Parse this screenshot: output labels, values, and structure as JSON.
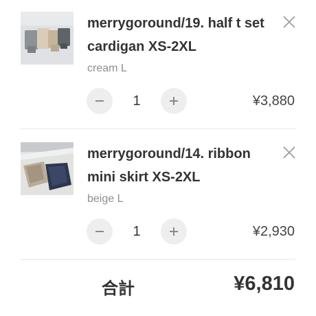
{
  "cart": {
    "items": [
      {
        "title_line1": "merrygoround/19. half t set",
        "title_line2": "cardigan XS-2XL",
        "variant": "cream L",
        "quantity": "1",
        "price": "¥3,880",
        "thumbnail_icon": "product-photo-cardigan-set"
      },
      {
        "title_line1": "merrygoround/14. ribbon",
        "title_line2": "mini skirt XS-2XL",
        "variant": "beige L",
        "quantity": "1",
        "price": "¥2,930",
        "thumbnail_icon": "product-photo-mini-skirts"
      }
    ]
  },
  "icons": {
    "remove": "close-icon",
    "decrease": "minus-icon",
    "increase": "plus-icon"
  },
  "summary": {
    "total_label": "合計",
    "total_value": "¥6,810"
  },
  "colors": {
    "text": "#333333",
    "muted": "#8e8e8e",
    "stepper_bg": "#eeeeee",
    "accent": "#2bb0a6"
  }
}
